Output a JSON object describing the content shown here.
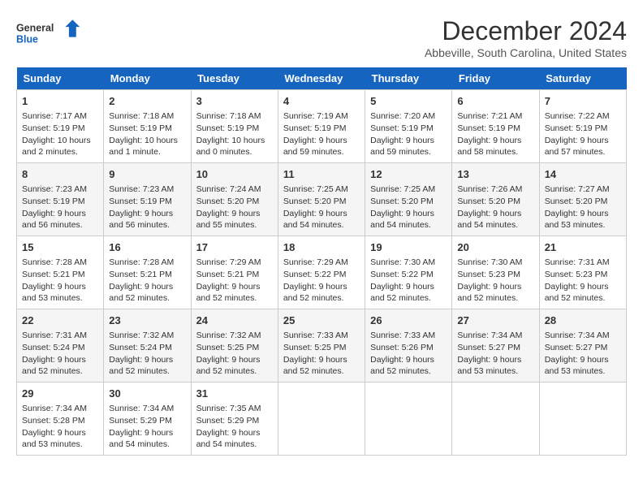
{
  "logo": {
    "line1": "General",
    "line2": "Blue"
  },
  "title": "December 2024",
  "subtitle": "Abbeville, South Carolina, United States",
  "weekdays": [
    "Sunday",
    "Monday",
    "Tuesday",
    "Wednesday",
    "Thursday",
    "Friday",
    "Saturday"
  ],
  "weeks": [
    [
      {
        "day": 1,
        "info": "Sunrise: 7:17 AM\nSunset: 5:19 PM\nDaylight: 10 hours\nand 2 minutes."
      },
      {
        "day": 2,
        "info": "Sunrise: 7:18 AM\nSunset: 5:19 PM\nDaylight: 10 hours\nand 1 minute."
      },
      {
        "day": 3,
        "info": "Sunrise: 7:18 AM\nSunset: 5:19 PM\nDaylight: 10 hours\nand 0 minutes."
      },
      {
        "day": 4,
        "info": "Sunrise: 7:19 AM\nSunset: 5:19 PM\nDaylight: 9 hours\nand 59 minutes."
      },
      {
        "day": 5,
        "info": "Sunrise: 7:20 AM\nSunset: 5:19 PM\nDaylight: 9 hours\nand 59 minutes."
      },
      {
        "day": 6,
        "info": "Sunrise: 7:21 AM\nSunset: 5:19 PM\nDaylight: 9 hours\nand 58 minutes."
      },
      {
        "day": 7,
        "info": "Sunrise: 7:22 AM\nSunset: 5:19 PM\nDaylight: 9 hours\nand 57 minutes."
      }
    ],
    [
      {
        "day": 8,
        "info": "Sunrise: 7:23 AM\nSunset: 5:19 PM\nDaylight: 9 hours\nand 56 minutes."
      },
      {
        "day": 9,
        "info": "Sunrise: 7:23 AM\nSunset: 5:19 PM\nDaylight: 9 hours\nand 56 minutes."
      },
      {
        "day": 10,
        "info": "Sunrise: 7:24 AM\nSunset: 5:20 PM\nDaylight: 9 hours\nand 55 minutes."
      },
      {
        "day": 11,
        "info": "Sunrise: 7:25 AM\nSunset: 5:20 PM\nDaylight: 9 hours\nand 54 minutes."
      },
      {
        "day": 12,
        "info": "Sunrise: 7:25 AM\nSunset: 5:20 PM\nDaylight: 9 hours\nand 54 minutes."
      },
      {
        "day": 13,
        "info": "Sunrise: 7:26 AM\nSunset: 5:20 PM\nDaylight: 9 hours\nand 54 minutes."
      },
      {
        "day": 14,
        "info": "Sunrise: 7:27 AM\nSunset: 5:20 PM\nDaylight: 9 hours\nand 53 minutes."
      }
    ],
    [
      {
        "day": 15,
        "info": "Sunrise: 7:28 AM\nSunset: 5:21 PM\nDaylight: 9 hours\nand 53 minutes."
      },
      {
        "day": 16,
        "info": "Sunrise: 7:28 AM\nSunset: 5:21 PM\nDaylight: 9 hours\nand 52 minutes."
      },
      {
        "day": 17,
        "info": "Sunrise: 7:29 AM\nSunset: 5:21 PM\nDaylight: 9 hours\nand 52 minutes."
      },
      {
        "day": 18,
        "info": "Sunrise: 7:29 AM\nSunset: 5:22 PM\nDaylight: 9 hours\nand 52 minutes."
      },
      {
        "day": 19,
        "info": "Sunrise: 7:30 AM\nSunset: 5:22 PM\nDaylight: 9 hours\nand 52 minutes."
      },
      {
        "day": 20,
        "info": "Sunrise: 7:30 AM\nSunset: 5:23 PM\nDaylight: 9 hours\nand 52 minutes."
      },
      {
        "day": 21,
        "info": "Sunrise: 7:31 AM\nSunset: 5:23 PM\nDaylight: 9 hours\nand 52 minutes."
      }
    ],
    [
      {
        "day": 22,
        "info": "Sunrise: 7:31 AM\nSunset: 5:24 PM\nDaylight: 9 hours\nand 52 minutes."
      },
      {
        "day": 23,
        "info": "Sunrise: 7:32 AM\nSunset: 5:24 PM\nDaylight: 9 hours\nand 52 minutes."
      },
      {
        "day": 24,
        "info": "Sunrise: 7:32 AM\nSunset: 5:25 PM\nDaylight: 9 hours\nand 52 minutes."
      },
      {
        "day": 25,
        "info": "Sunrise: 7:33 AM\nSunset: 5:25 PM\nDaylight: 9 hours\nand 52 minutes."
      },
      {
        "day": 26,
        "info": "Sunrise: 7:33 AM\nSunset: 5:26 PM\nDaylight: 9 hours\nand 52 minutes."
      },
      {
        "day": 27,
        "info": "Sunrise: 7:34 AM\nSunset: 5:27 PM\nDaylight: 9 hours\nand 53 minutes."
      },
      {
        "day": 28,
        "info": "Sunrise: 7:34 AM\nSunset: 5:27 PM\nDaylight: 9 hours\nand 53 minutes."
      }
    ],
    [
      {
        "day": 29,
        "info": "Sunrise: 7:34 AM\nSunset: 5:28 PM\nDaylight: 9 hours\nand 53 minutes."
      },
      {
        "day": 30,
        "info": "Sunrise: 7:34 AM\nSunset: 5:29 PM\nDaylight: 9 hours\nand 54 minutes."
      },
      {
        "day": 31,
        "info": "Sunrise: 7:35 AM\nSunset: 5:29 PM\nDaylight: 9 hours\nand 54 minutes."
      },
      null,
      null,
      null,
      null
    ]
  ]
}
